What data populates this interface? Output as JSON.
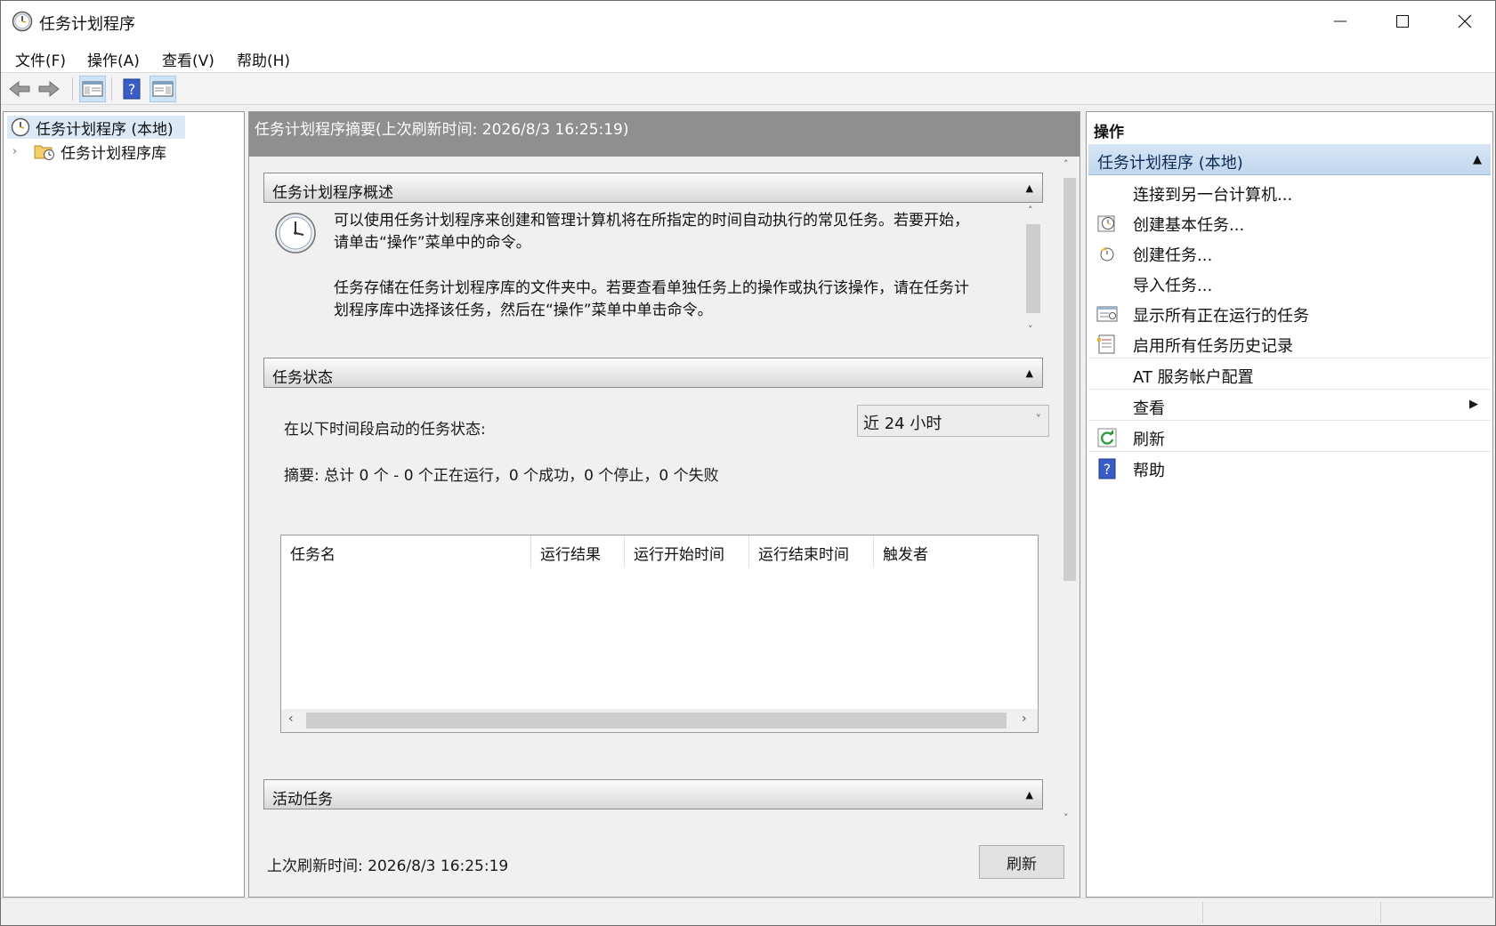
{
  "window": {
    "title": "任务计划程序",
    "controls": {
      "minimize": "minimize-icon",
      "maximize": "maximize-icon",
      "close": "close-icon"
    }
  },
  "menu": [
    "文件(F)",
    "操作(A)",
    "查看(V)",
    "帮助(H)"
  ],
  "toolbar": [
    "back-arrow-icon",
    "forward-arrow-icon",
    "show-hide-console-tree-icon",
    "help-icon",
    "show-hide-action-pane-icon"
  ],
  "tree": {
    "root": "任务计划程序 (本地)",
    "library": "任务计划程序库"
  },
  "center": {
    "header": "任务计划程序摘要(上次刷新时间: 2026/8/3 16:25:19)",
    "overview": {
      "title": "任务计划程序概述",
      "text1": "可以使用任务计划程序来创建和管理计算机将在所指定的时间自动执行的常见任务。若要开始，请单击“操作”菜单中的命令。",
      "text2": "任务存储在任务计划程序库的文件夹中。若要查看单独任务上的操作或执行该操作，请在任务计划程序库中选择该任务，然后在“操作”菜单中单击命令。"
    },
    "status": {
      "title": "任务状态",
      "period_label": "在以下时间段启动的任务状态:",
      "period_value": "近 24 小时",
      "summary": "摘要: 总计 0 个 - 0 个正在运行，0 个成功，0 个停止，0 个失败",
      "columns": [
        "任务名",
        "运行结果",
        "运行开始时间",
        "运行结束时间",
        "触发者"
      ]
    },
    "active": {
      "title": "活动任务"
    },
    "last_refresh": "上次刷新时间: 2026/8/3 16:25:19",
    "refresh_button": "刷新"
  },
  "actions": {
    "title": "操作",
    "group": "任务计划程序 (本地)",
    "items": [
      {
        "label": "连接到另一台计算机...",
        "icon": ""
      },
      {
        "label": "创建基本任务...",
        "icon": "create-basic-task-icon"
      },
      {
        "label": "创建任务...",
        "icon": "create-task-icon"
      },
      {
        "label": "导入任务...",
        "icon": ""
      },
      {
        "label": "显示所有正在运行的任务",
        "icon": "running-tasks-icon"
      },
      {
        "label": "启用所有任务历史记录",
        "icon": "history-icon"
      },
      {
        "label": "AT 服务帐户配置",
        "icon": ""
      },
      {
        "label": "查看",
        "icon": ""
      },
      {
        "label": "刷新",
        "icon": "refresh-icon"
      },
      {
        "label": "帮助",
        "icon": "help-icon"
      }
    ]
  },
  "colors": {
    "selection": "#dbe8f5",
    "header_gray": "#8f8f8f",
    "action_group": "#c9dcf0"
  }
}
